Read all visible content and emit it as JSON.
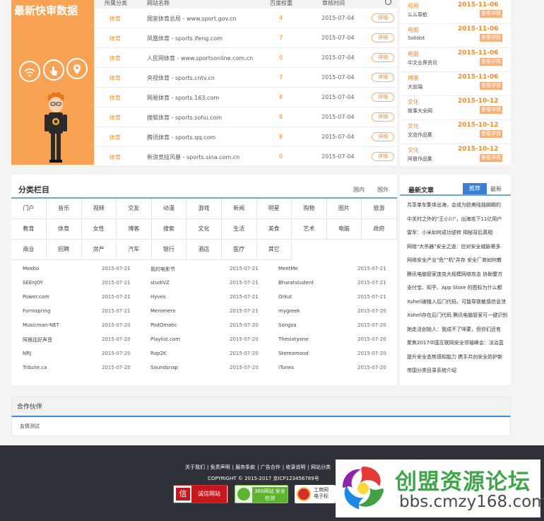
{
  "banner": {
    "title": "最新快审数据"
  },
  "table": {
    "headers": [
      "所属分类",
      "网站名称",
      "百度权重",
      "审核时间"
    ],
    "rows": [
      {
        "cat": "体育",
        "name": "国家体育总局 - www.sport.gov.cn",
        "num": "4",
        "date": "2015-07-04",
        "btn": "详细"
      },
      {
        "cat": "体育",
        "name": "凤凰体育 - sports.ifeng.com",
        "num": "7",
        "date": "2015-07-04",
        "btn": "详细"
      },
      {
        "cat": "体育",
        "name": "人民网体育 - www.sportsonline.com.cn",
        "num": "0",
        "date": "2015-07-04",
        "btn": "详细"
      },
      {
        "cat": "体育",
        "name": "央视体育 - sports.cntv.cn",
        "num": "7",
        "date": "2015-07-04",
        "btn": "详细"
      },
      {
        "cat": "体育",
        "name": "网易体育 - sports.163.com",
        "num": "8",
        "date": "2015-07-04",
        "btn": "详细"
      },
      {
        "cat": "体育",
        "name": "搜狐体育 - sports.sohu.com",
        "num": "8",
        "date": "2015-07-04",
        "btn": "详细"
      },
      {
        "cat": "体育",
        "name": "腾讯体育 - sports.qq.com",
        "num": "8",
        "date": "2015-07-04",
        "btn": "详细"
      },
      {
        "cat": "体育",
        "name": "新浪竞技风暴 - sports.sina.com.cn",
        "num": "0",
        "date": "2015-07-04",
        "btn": "详细"
      }
    ]
  },
  "right_list": [
    {
      "cat": "视频",
      "date": "2015-11-06",
      "name": "么么导航",
      "btn": "查看详情"
    },
    {
      "cat": "电脑",
      "date": "2015-11-06",
      "name": "Solidot",
      "btn": "查看详情"
    },
    {
      "cat": "电脑",
      "date": "2015-11-06",
      "name": "中文业界资讯",
      "btn": "查看详情"
    },
    {
      "cat": "博客",
      "date": "2015-11-06",
      "name": "大前端",
      "btn": "查看详情"
    },
    {
      "cat": "文化",
      "date": "2015-10-12",
      "name": "故事大全网",
      "btn": "查看详情"
    },
    {
      "cat": "文化",
      "date": "2015-10-12",
      "name": "文览作品集",
      "btn": "查看详情"
    },
    {
      "cat": "文化",
      "date": "2015-10-12",
      "name": "阿普作品集",
      "btn": "查看详情"
    }
  ],
  "category": {
    "title": "分类栏目",
    "tabs": [
      "国内",
      "国外"
    ],
    "cells": [
      "门户",
      "音乐",
      "视频",
      "交友",
      "动漫",
      "游戏",
      "新闻",
      "明星",
      "购物",
      "图片",
      "旅游",
      "教育",
      "体育",
      "女性",
      "博客",
      "搜索",
      "文化",
      "生活",
      "美食",
      "艺术",
      "电脑",
      "政府",
      "商业",
      "招聘",
      "房产",
      "汽车",
      "银行",
      "酒店",
      "医疗",
      "其它"
    ],
    "sites": [
      [
        "Meebo",
        "2015-07-21",
        "氮的电影节",
        "2015-07-21",
        "MeetMe",
        "2015-07-21"
      ],
      [
        "SEEnJOY",
        "2015-07-21",
        "studiVZ",
        "2015-07-21",
        "Bharatstudent",
        "2015-07-21"
      ],
      [
        "Power.com",
        "2015-07-21",
        "Hyves",
        "2015-07-21",
        "Orkut",
        "2015-07-21"
      ],
      [
        "Formspring",
        "2015-07-21",
        "Meromero",
        "2015-07-21",
        "mygreek",
        "2015-07-20"
      ],
      [
        "Musicman-NET",
        "2015-07-20",
        "PodOmatic",
        "2015-07-20",
        "Songza",
        "2015-07-20"
      ],
      [
        "阿根廷好声音",
        "2015-07-20",
        "Playlist.com",
        "2015-07-20",
        "Thesixtyone",
        "2015-07-20"
      ],
      [
        "NRJ",
        "2015-07-20",
        "Rap2K",
        "2015-07-20",
        "Stereomood",
        "2015-07-20"
      ],
      [
        "Tribute.ca",
        "2015-07-20",
        "Soundsnap",
        "2015-07-20",
        "iTunes",
        "2015-07-20"
      ]
    ]
  },
  "articles": {
    "title": "最新文章",
    "tab_active": "推荐",
    "tab": "最新",
    "items": [
      "共享单车集体出海，会成为欧美陆独脚踢的",
      "中关村之外的\"王小川\"，出海攻下11亿用户",
      "雷军：小米如何成功逆转 揭秘背后真相",
      "网络\"大杀器\"安全之道：应对安全威胁需多",
      "网络安全产业\"危\"\"机\"并存 安全厂商如何教",
      "腾讯电脑管家连克大规模网络攻击 协助警方",
      "支付宝、知乎、App Store 的图标为什么都",
      "Xshell被植入后门代码，可能导致敏感信息泄",
      "Xshell存在后门代码 腾讯电脑管家可一键识别",
      "她走活创始人：我成不了咪蒙，但你们还有",
      "聚焦2017中国互联网安全领袖峰会：法治蓝",
      "提升安全态势感知能力 携手共创安全防护新",
      "帝国分类目录系统介绍"
    ]
  },
  "partners": {
    "title": "合作伙伴",
    "link": "友情测试"
  },
  "footer": {
    "links": [
      "关于我们",
      "免责声明",
      "服务条款",
      "广告合作",
      "收录说明",
      "网站分类"
    ],
    "copyright": "COPYRIGHT © 2015-2017 京ICP123456789号",
    "badges": [
      "诚信网站",
      "360网站 安全检测",
      "工商网 电子标"
    ]
  },
  "watermark": {
    "line1": "创盟资源论坛",
    "line2": "bbs.cmzy168.com"
  },
  "colors": {
    "orange": "#f8a254",
    "accent_orange": "#f08c2a",
    "blue": "#3b7fd1",
    "footer_bg": "#2f3138"
  }
}
